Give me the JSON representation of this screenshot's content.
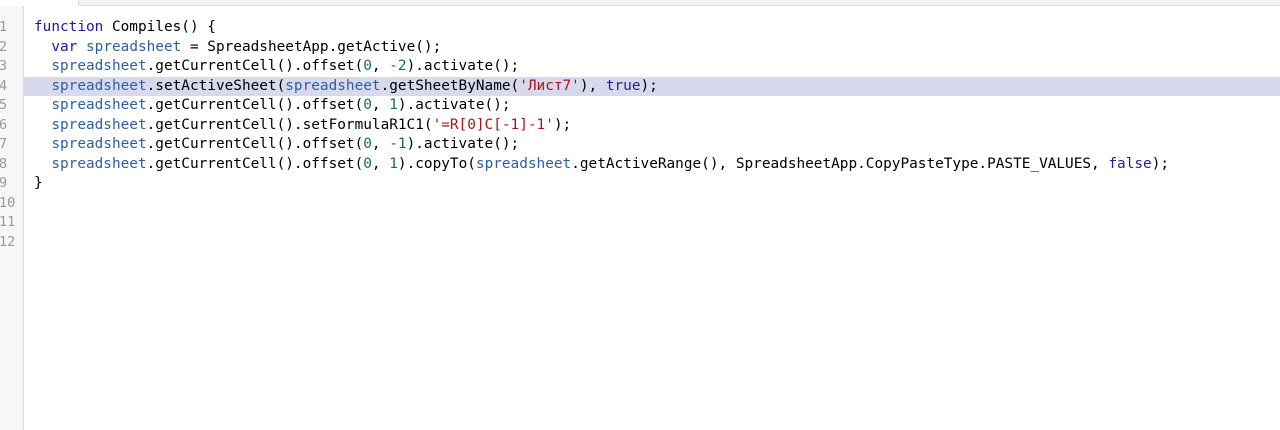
{
  "editor": {
    "line_numbers": [
      "1",
      "2",
      "3",
      "4",
      "5",
      "6",
      "7",
      "8",
      "9",
      "10",
      "11",
      "12"
    ],
    "active_line": 4,
    "colors": {
      "keyword": "#1c1c9c",
      "variable": "#2d5fa3",
      "number": "#1a6b5a",
      "string": "#a31515",
      "active_line_bg": "#d9d9ee",
      "gutter_bg": "#f7f7f7"
    },
    "lines": [
      [
        {
          "t": "function",
          "c": "kw"
        },
        {
          "t": " Compiles() {",
          "c": "plain"
        }
      ],
      [
        {
          "t": "  ",
          "c": "plain"
        },
        {
          "t": "var",
          "c": "kw"
        },
        {
          "t": " ",
          "c": "plain"
        },
        {
          "t": "spreadsheet",
          "c": "def"
        },
        {
          "t": " = SpreadsheetApp.getActive();",
          "c": "plain"
        }
      ],
      [
        {
          "t": "  ",
          "c": "plain"
        },
        {
          "t": "spreadsheet",
          "c": "var"
        },
        {
          "t": ".getCurrentCell().offset(",
          "c": "plain"
        },
        {
          "t": "0",
          "c": "num"
        },
        {
          "t": ", ",
          "c": "plain"
        },
        {
          "t": "-2",
          "c": "num"
        },
        {
          "t": ").activate();",
          "c": "plain"
        }
      ],
      [
        {
          "t": "  ",
          "c": "plain"
        },
        {
          "t": "spreadsheet",
          "c": "var"
        },
        {
          "t": ".setActiveSheet(",
          "c": "plain"
        },
        {
          "t": "spreadsheet",
          "c": "var"
        },
        {
          "t": ".getSheetByName(",
          "c": "plain"
        },
        {
          "t": "'Лист7'",
          "c": "str"
        },
        {
          "t": "), ",
          "c": "plain"
        },
        {
          "t": "true",
          "c": "kw"
        },
        {
          "t": ");",
          "c": "plain"
        }
      ],
      [
        {
          "t": "  ",
          "c": "plain"
        },
        {
          "t": "spreadsheet",
          "c": "var"
        },
        {
          "t": ".getCurrentCell().offset(",
          "c": "plain"
        },
        {
          "t": "0",
          "c": "num"
        },
        {
          "t": ", ",
          "c": "plain"
        },
        {
          "t": "1",
          "c": "num"
        },
        {
          "t": ").activate();",
          "c": "plain"
        }
      ],
      [
        {
          "t": "  ",
          "c": "plain"
        },
        {
          "t": "spreadsheet",
          "c": "var"
        },
        {
          "t": ".getCurrentCell().setFormulaR1C1(",
          "c": "plain"
        },
        {
          "t": "'=R[0]C[-1]-1'",
          "c": "str"
        },
        {
          "t": ");",
          "c": "plain"
        }
      ],
      [
        {
          "t": "  ",
          "c": "plain"
        },
        {
          "t": "spreadsheet",
          "c": "var"
        },
        {
          "t": ".getCurrentCell().offset(",
          "c": "plain"
        },
        {
          "t": "0",
          "c": "num"
        },
        {
          "t": ", ",
          "c": "plain"
        },
        {
          "t": "-1",
          "c": "num"
        },
        {
          "t": ").activate();",
          "c": "plain"
        }
      ],
      [
        {
          "t": "  ",
          "c": "plain"
        },
        {
          "t": "spreadsheet",
          "c": "var"
        },
        {
          "t": ".getCurrentCell().offset(",
          "c": "plain"
        },
        {
          "t": "0",
          "c": "num"
        },
        {
          "t": ", ",
          "c": "plain"
        },
        {
          "t": "1",
          "c": "num"
        },
        {
          "t": ").copyTo(",
          "c": "plain"
        },
        {
          "t": "spreadsheet",
          "c": "var"
        },
        {
          "t": ".getActiveRange(), SpreadsheetApp.CopyPasteType.PASTE_VALUES, ",
          "c": "plain"
        },
        {
          "t": "false",
          "c": "kw"
        },
        {
          "t": ");",
          "c": "plain"
        }
      ],
      [
        {
          "t": "}",
          "c": "plain"
        }
      ],
      [],
      [],
      []
    ]
  }
}
